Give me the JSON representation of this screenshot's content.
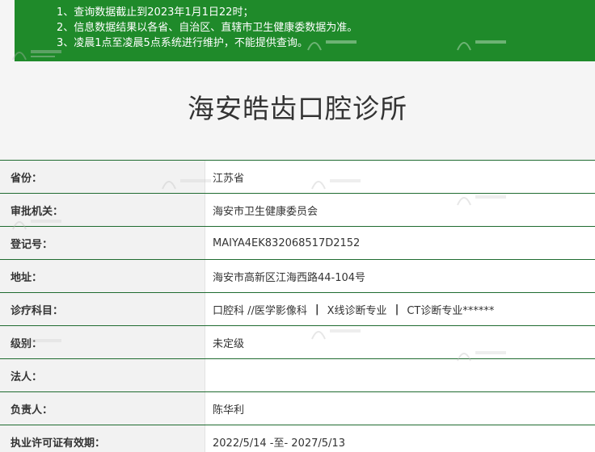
{
  "notice": {
    "lines": [
      "1、查询数据截止到2023年1月1日22时；",
      "2、信息数据结果以各省、自治区、直辖市卫生健康委数据为准。",
      "3、凌晨1点至凌晨5点系统进行维护，不能提供查询。"
    ]
  },
  "page_title": "海安皓齿口腔诊所",
  "rows": [
    {
      "label": "省份：",
      "value": "江苏省"
    },
    {
      "label": "审批机关：",
      "value": "海安市卫生健康委员会"
    },
    {
      "label": "登记号：",
      "value": "MAIYA4EK832068517D2152"
    },
    {
      "label": "地址：",
      "value": "海安市高新区江海西路44-104号"
    },
    {
      "label": "诊疗科目：",
      "value_parts": [
        "口腔科 //医学影像科",
        "|",
        "X线诊断专业",
        "|",
        "CT诊断专业******"
      ]
    },
    {
      "label": "级别：",
      "value": "未定级"
    },
    {
      "label": "法人：",
      "value": ""
    },
    {
      "label": "负责人：",
      "value": "陈华利"
    },
    {
      "label": "执业许可证有效期：",
      "value": "2022/5/14 -至- 2027/5/13"
    }
  ],
  "colors": {
    "notice_bg": "#1f8a2a",
    "row_border": "#1f6b30",
    "label_bg": "#f2f2f2",
    "value_bg": "#ffffff"
  }
}
